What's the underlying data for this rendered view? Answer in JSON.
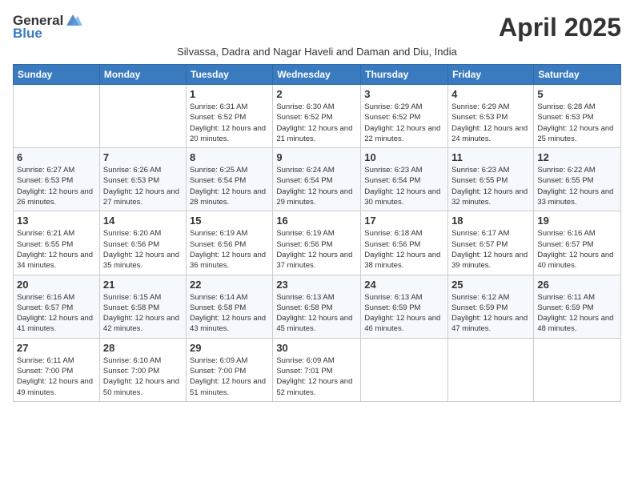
{
  "header": {
    "logo_general": "General",
    "logo_blue": "Blue",
    "month_title": "April 2025",
    "subtitle": "Silvassa, Dadra and Nagar Haveli and Daman and Diu, India"
  },
  "days_of_week": [
    "Sunday",
    "Monday",
    "Tuesday",
    "Wednesday",
    "Thursday",
    "Friday",
    "Saturday"
  ],
  "weeks": [
    [
      {
        "day": "",
        "info": ""
      },
      {
        "day": "",
        "info": ""
      },
      {
        "day": "1",
        "info": "Sunrise: 6:31 AM\nSunset: 6:52 PM\nDaylight: 12 hours and 20 minutes."
      },
      {
        "day": "2",
        "info": "Sunrise: 6:30 AM\nSunset: 6:52 PM\nDaylight: 12 hours and 21 minutes."
      },
      {
        "day": "3",
        "info": "Sunrise: 6:29 AM\nSunset: 6:52 PM\nDaylight: 12 hours and 22 minutes."
      },
      {
        "day": "4",
        "info": "Sunrise: 6:29 AM\nSunset: 6:53 PM\nDaylight: 12 hours and 24 minutes."
      },
      {
        "day": "5",
        "info": "Sunrise: 6:28 AM\nSunset: 6:53 PM\nDaylight: 12 hours and 25 minutes."
      }
    ],
    [
      {
        "day": "6",
        "info": "Sunrise: 6:27 AM\nSunset: 6:53 PM\nDaylight: 12 hours and 26 minutes."
      },
      {
        "day": "7",
        "info": "Sunrise: 6:26 AM\nSunset: 6:53 PM\nDaylight: 12 hours and 27 minutes."
      },
      {
        "day": "8",
        "info": "Sunrise: 6:25 AM\nSunset: 6:54 PM\nDaylight: 12 hours and 28 minutes."
      },
      {
        "day": "9",
        "info": "Sunrise: 6:24 AM\nSunset: 6:54 PM\nDaylight: 12 hours and 29 minutes."
      },
      {
        "day": "10",
        "info": "Sunrise: 6:23 AM\nSunset: 6:54 PM\nDaylight: 12 hours and 30 minutes."
      },
      {
        "day": "11",
        "info": "Sunrise: 6:23 AM\nSunset: 6:55 PM\nDaylight: 12 hours and 32 minutes."
      },
      {
        "day": "12",
        "info": "Sunrise: 6:22 AM\nSunset: 6:55 PM\nDaylight: 12 hours and 33 minutes."
      }
    ],
    [
      {
        "day": "13",
        "info": "Sunrise: 6:21 AM\nSunset: 6:55 PM\nDaylight: 12 hours and 34 minutes."
      },
      {
        "day": "14",
        "info": "Sunrise: 6:20 AM\nSunset: 6:56 PM\nDaylight: 12 hours and 35 minutes."
      },
      {
        "day": "15",
        "info": "Sunrise: 6:19 AM\nSunset: 6:56 PM\nDaylight: 12 hours and 36 minutes."
      },
      {
        "day": "16",
        "info": "Sunrise: 6:19 AM\nSunset: 6:56 PM\nDaylight: 12 hours and 37 minutes."
      },
      {
        "day": "17",
        "info": "Sunrise: 6:18 AM\nSunset: 6:56 PM\nDaylight: 12 hours and 38 minutes."
      },
      {
        "day": "18",
        "info": "Sunrise: 6:17 AM\nSunset: 6:57 PM\nDaylight: 12 hours and 39 minutes."
      },
      {
        "day": "19",
        "info": "Sunrise: 6:16 AM\nSunset: 6:57 PM\nDaylight: 12 hours and 40 minutes."
      }
    ],
    [
      {
        "day": "20",
        "info": "Sunrise: 6:16 AM\nSunset: 6:57 PM\nDaylight: 12 hours and 41 minutes."
      },
      {
        "day": "21",
        "info": "Sunrise: 6:15 AM\nSunset: 6:58 PM\nDaylight: 12 hours and 42 minutes."
      },
      {
        "day": "22",
        "info": "Sunrise: 6:14 AM\nSunset: 6:58 PM\nDaylight: 12 hours and 43 minutes."
      },
      {
        "day": "23",
        "info": "Sunrise: 6:13 AM\nSunset: 6:58 PM\nDaylight: 12 hours and 45 minutes."
      },
      {
        "day": "24",
        "info": "Sunrise: 6:13 AM\nSunset: 6:59 PM\nDaylight: 12 hours and 46 minutes."
      },
      {
        "day": "25",
        "info": "Sunrise: 6:12 AM\nSunset: 6:59 PM\nDaylight: 12 hours and 47 minutes."
      },
      {
        "day": "26",
        "info": "Sunrise: 6:11 AM\nSunset: 6:59 PM\nDaylight: 12 hours and 48 minutes."
      }
    ],
    [
      {
        "day": "27",
        "info": "Sunrise: 6:11 AM\nSunset: 7:00 PM\nDaylight: 12 hours and 49 minutes."
      },
      {
        "day": "28",
        "info": "Sunrise: 6:10 AM\nSunset: 7:00 PM\nDaylight: 12 hours and 50 minutes."
      },
      {
        "day": "29",
        "info": "Sunrise: 6:09 AM\nSunset: 7:00 PM\nDaylight: 12 hours and 51 minutes."
      },
      {
        "day": "30",
        "info": "Sunrise: 6:09 AM\nSunset: 7:01 PM\nDaylight: 12 hours and 52 minutes."
      },
      {
        "day": "",
        "info": ""
      },
      {
        "day": "",
        "info": ""
      },
      {
        "day": "",
        "info": ""
      }
    ]
  ]
}
